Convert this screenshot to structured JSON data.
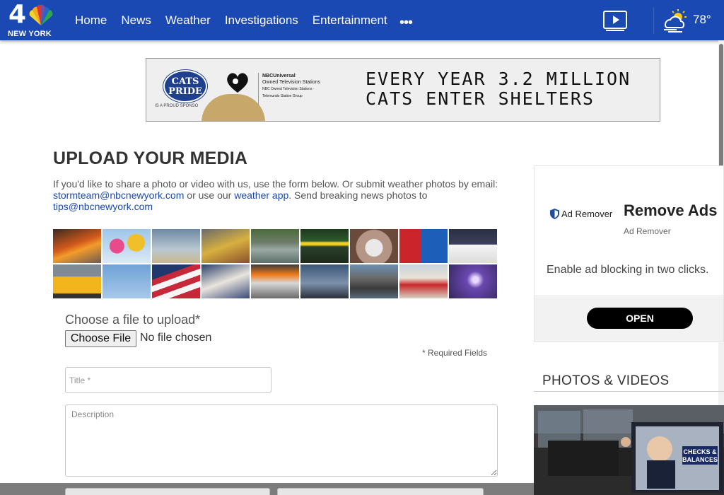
{
  "header": {
    "logo_number": "4",
    "logo_city": "NEW YORK",
    "nav": [
      "Home",
      "News",
      "Weather",
      "Investigations",
      "Entertainment"
    ],
    "more_glyph": "•••",
    "video_icon": "tv-play-icon",
    "weather_icon": "partly-cloudy-icon",
    "temperature": "78°"
  },
  "banner_ad": {
    "brand": "CATS PRIDE",
    "sponsor_text": "IS A PROUD SPONSO",
    "partner_title": "NBCUniversal",
    "partner_sub": "Owned Television Stations",
    "partner_small": "NBC Owned Television Stations · Telemundo Station Group",
    "headline_line1": "EVERY YEAR 3.2 MILLION",
    "headline_line2": "CATS ENTER SHELTERS"
  },
  "main": {
    "title": "UPLOAD YOUR MEDIA",
    "intro_prefix": "If you'd like to share a photo or video with us, use the form below. Or submit weather photos by email:",
    "email_weather": "stormteam@nbcnewyork.com",
    "intro_middle": " or use our ",
    "weather_app_link": "weather app",
    "intro_suffix": ". Send breaking news photos to",
    "email_news": "tips@nbcnewyork.com",
    "mosaic_tiles": [
      "explosion-smoke",
      "hot-air-balloons",
      "tornado",
      "firefighters",
      "flooded-car",
      "police-tape",
      "hailstones",
      "gas-prices",
      "police-car",
      "school-bus",
      "helicopter",
      "american-flag",
      "baseball-fans",
      "truck-fire",
      "bridge-skyline",
      "smoke-cloud",
      "cyclone-coaster",
      "lightning"
    ]
  },
  "form": {
    "file_label": "Choose a file to upload*",
    "choose_button": "Choose File",
    "no_file_text": "No file chosen",
    "required_note": "*  Required Fields",
    "title_placeholder": "Title *",
    "description_placeholder": "Description"
  },
  "side_ad": {
    "logo_text": "Ad Remover",
    "headline": "Remove Ads",
    "sub": "Ad Remover",
    "body": "Enable ad blocking in two clicks.",
    "cta": "OPEN"
  },
  "photos_videos": {
    "title": "PHOTOS & VIDEOS",
    "graphic_text_line1": "CHECKS &",
    "graphic_text_line2": "BALANCES"
  },
  "colors": {
    "header_blue": "#1a49b3",
    "link_blue": "#1a49b3"
  }
}
